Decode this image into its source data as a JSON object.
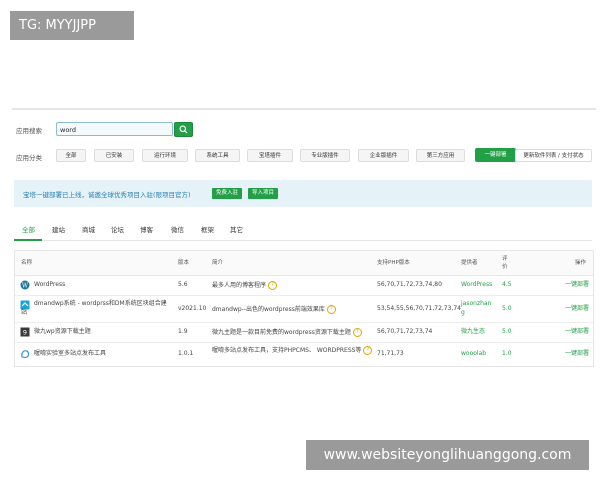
{
  "watermark_top": "TG: MYYJJPP",
  "watermark_bottom": "www.websiteyonglihuanggong.com",
  "search": {
    "label": "应用搜索",
    "value": "word"
  },
  "categories": {
    "label": "应用分类",
    "items": [
      "全部",
      "已安装",
      "运行环境",
      "系统工具",
      "宝塔插件",
      "专业版插件",
      "企业版插件",
      "第三方应用"
    ],
    "deploy": "一键部署",
    "update": "更新软件列表 / 支付状态"
  },
  "banner": {
    "text": "宝塔一键部署已上线，诚邀全球优秀项目入驻(限项目官方)",
    "btn1": "免费入驻",
    "btn2": "导入项目"
  },
  "tabs": [
    "全部",
    "建站",
    "商城",
    "论坛",
    "博客",
    "微信",
    "框架",
    "其它"
  ],
  "table": {
    "headers": {
      "name": "名称",
      "version": "版本",
      "desc": "简介",
      "php": "支持PHP版本",
      "provider": "提供者",
      "rating1": "评",
      "rating2": "价",
      "action": "操作"
    },
    "rows": [
      {
        "name1": "WordPress",
        "name2": "",
        "version": "5.6",
        "desc1": "最多人用的博客程序",
        "desc2": "",
        "php": "56,70,71,72,73,74,80",
        "provider1": "WordPress",
        "provider2": "",
        "rating": "4.5",
        "action": "一键部署",
        "icon": "wordpress-logo-icon"
      },
      {
        "name1": "dmandwp系统 - wordprss和DM系统区块组合建",
        "name2": "站",
        "version": "v2021.10",
        "desc1": "dmandwp--出色的wordpress前端效果库",
        "desc2": "",
        "php": "53,54,55,56,70,71,72,73,74",
        "provider1": "jasonzhan",
        "provider2": "g",
        "rating": "5.0",
        "action": "一键部署",
        "icon": "dmandwp-logo-icon"
      },
      {
        "name1": "微九wp资源下载主题",
        "name2": "",
        "version": "1.9",
        "desc1": "微九主题是一款目前免费的wordpress资源下载主题",
        "desc2": "",
        "php": "56,70,71,72,73,74",
        "provider1": "微九生态",
        "provider2": "",
        "rating": "5.0",
        "action": "一键部署",
        "icon": "weijiu-logo-icon"
      },
      {
        "name1": "喔唷实验室多站点发布工具",
        "name2": "",
        "version": "1.0.1",
        "desc1": "喔唷多站点发布工具，支持PHPCMS、 WORDPRESS等",
        "desc2": "",
        "php": "71,71,73",
        "provider1": "wooolab",
        "provider2": "",
        "rating": "1.0",
        "action": "一键部署",
        "icon": "wooolab-logo-icon"
      }
    ]
  },
  "colors": {
    "accent": "#23a047",
    "banner_bg": "#e5f2f8",
    "banner_text": "#2a7fb0"
  }
}
